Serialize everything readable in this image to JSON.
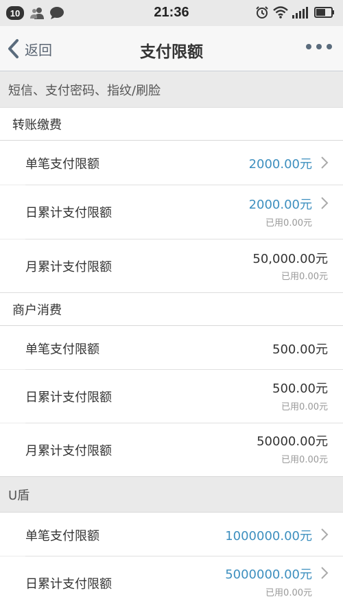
{
  "status": {
    "badge": "10",
    "time": "21:36"
  },
  "nav": {
    "back_label": "返回",
    "title": "支付限额"
  },
  "section1": {
    "title": "短信、支付密码、指纹/刷脸",
    "group1": {
      "title": "转账缴费",
      "rows": [
        {
          "label": "单笔支付限额",
          "value": "2000.00元"
        },
        {
          "label": "日累计支付限额",
          "value": "2000.00元",
          "used": "已用0.00元"
        },
        {
          "label": "月累计支付限额",
          "value": "50,000.00元",
          "used": "已用0.00元"
        }
      ]
    },
    "group2": {
      "title": "商户消费",
      "rows": [
        {
          "label": "单笔支付限额",
          "value": "500.00元"
        },
        {
          "label": "日累计支付限额",
          "value": "500.00元",
          "used": "已用0.00元"
        },
        {
          "label": "月累计支付限额",
          "value": "50000.00元",
          "used": "已用0.00元"
        }
      ]
    }
  },
  "section2": {
    "title": "U盾",
    "rows": [
      {
        "label": "单笔支付限额",
        "value": "1000000.00元"
      },
      {
        "label": "日累计支付限额",
        "value": "5000000.00元",
        "used": "已用0.00元"
      }
    ]
  },
  "colors": {
    "link": "#3d8fbf",
    "nav_icon": "#5a6b7c"
  }
}
